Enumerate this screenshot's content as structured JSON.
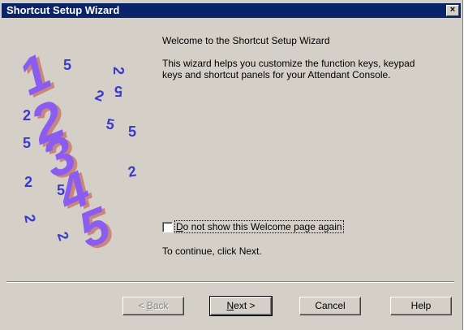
{
  "window": {
    "title": "Shortcut Setup Wizard",
    "close_glyph": "×"
  },
  "content": {
    "welcome": "Welcome to the Shortcut Setup Wizard",
    "description": "This wizard helps you customize the function keys, keypad keys and shortcut panels for your Attendant Console.",
    "checkbox_label_prefix": "D",
    "checkbox_label_rest": "o not show this Welcome page again",
    "checkbox_checked": false,
    "continue_text": "To continue, click Next."
  },
  "illustration": {
    "big_numbers": [
      "1",
      "2",
      "3",
      "4",
      "5"
    ],
    "small_arrows": [
      "5",
      "2",
      "2",
      "5",
      "2",
      "5",
      "5",
      "5",
      "2",
      "2",
      "5",
      "2",
      "2"
    ],
    "colors": {
      "face": "#8a5cf0",
      "shadow": "#c8877a",
      "arrow": "#3a3ad0"
    }
  },
  "buttons": {
    "back": {
      "accel": "B",
      "rest": "ack",
      "prefix": "< "
    },
    "next": {
      "accel": "N",
      "rest": "ext >"
    },
    "cancel": "Cancel",
    "help": "Help"
  }
}
